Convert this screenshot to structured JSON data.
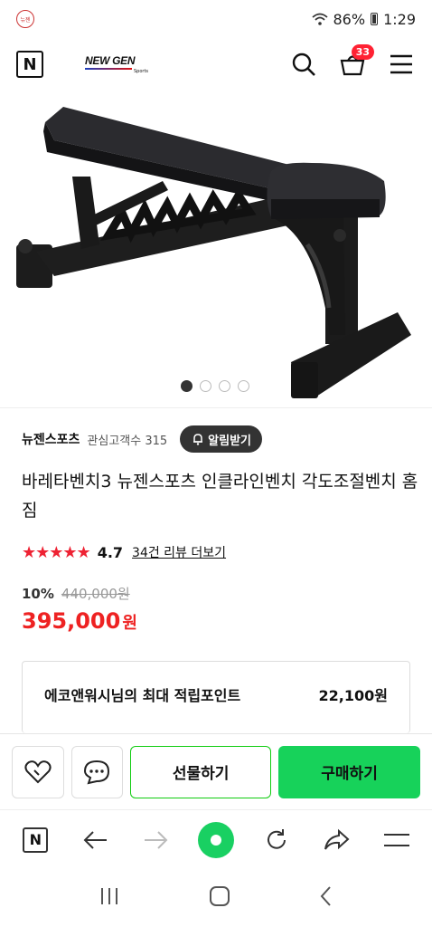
{
  "status_bar": {
    "battery": "86%",
    "time": "1:29",
    "app_icon_text": "뉴젠"
  },
  "header": {
    "brand_name": "NEW GEN",
    "brand_sub": "Sports",
    "cart_count": "33",
    "logo_letter": "N"
  },
  "gallery": {
    "total": 4,
    "active_index": 0
  },
  "store": {
    "name": "뉴젠스포츠",
    "followers_label": "관심고객수 315",
    "alarm_label": "알림받기"
  },
  "product": {
    "title": "바레타벤치3 뉴젠스포츠 인클라인벤치 각도조절벤치 홈짐",
    "rating": "4.7",
    "rating_value": 4.7,
    "reviews_label": "34건 리뷰 더보기",
    "discount": "10%",
    "original_price": "440,000원",
    "price": "395,000",
    "price_unit": "원"
  },
  "points": {
    "label": "에코앤워시님의 최대 적립포인트",
    "value": "22,100원"
  },
  "buy_bar": {
    "gift_label": "선물하기",
    "buy_label": "구매하기"
  },
  "colors": {
    "accent_green": "#17d25a",
    "price_red": "#e22",
    "star_red": "#e23"
  }
}
